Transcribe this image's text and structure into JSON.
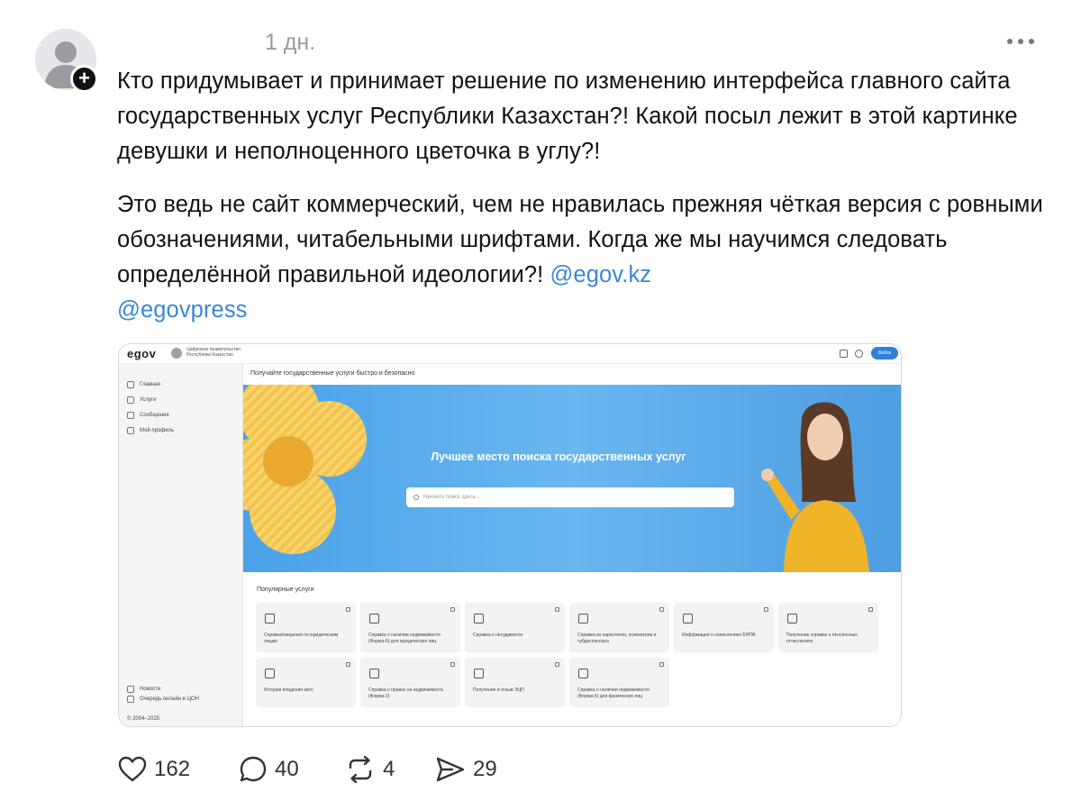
{
  "post": {
    "timestamp": "1 дн.",
    "paragraph1": "Кто придумывает и принимает решение по изменению интерфейса главного сайта государственных услуг Республики Казахстан?! Какой посыл лежит в этой картинке девушки и неполноценного цветочка в углу?!",
    "paragraph2_text": "Это ведь не сайт коммерческий, чем не нравилась прежняя чёткая версия с ровными обозначениями, читабельными шрифтами. Когда же мы научимся следовать определённой правильной идеологии?! ",
    "mention1": "@egov.kz",
    "mention2": "@egovpress",
    "follow_symbol": "+"
  },
  "screenshot": {
    "logo": "egov",
    "gov_name": "Цифровое правительство Республики Казахстан",
    "login": "Войти",
    "sidebar": [
      {
        "label": "Главная"
      },
      {
        "label": "Услуги"
      },
      {
        "label": "Сообщения"
      },
      {
        "label": "Мой профиль"
      }
    ],
    "sidebar_bottom": [
      {
        "label": "Новости"
      },
      {
        "label": "Очередь онлайн в ЦОН"
      }
    ],
    "copyright": "© 2004–2025",
    "headline": "Получайте государственные услуги быстро и безопасно",
    "hero_title": "Лучшее место поиска государственных услуг",
    "search_placeholder": "Начните поиск здесь...",
    "popular_title": "Популярные услуги",
    "cards": [
      {
        "text": "Справка/сведения по юридическим лицам"
      },
      {
        "text": "Справка о наличии недвижимости (Форма-6) для юридических лиц"
      },
      {
        "text": "Справка о несудимости"
      },
      {
        "text": "Справка из наркологии, психиатрии и тубдиспансера"
      },
      {
        "text": "Информация о начислениях ЕНПФ"
      },
      {
        "text": "Получение справки о пенсионных отчислениях"
      },
      {
        "text": "История владения авто"
      },
      {
        "text": "Справка о правах на недвижимость (Форма-2)"
      },
      {
        "text": "Получение и отзыв ЭЦП"
      },
      {
        "text": "Справка о наличии недвижимости (Форма-6) для физических лиц"
      }
    ]
  },
  "actions": {
    "likes": "162",
    "comments": "40",
    "reposts": "4",
    "shares": "29"
  },
  "colors": {
    "mention": "#3a86d6",
    "hero_blue": "#5aacec",
    "login_button": "#2f7fdb"
  }
}
